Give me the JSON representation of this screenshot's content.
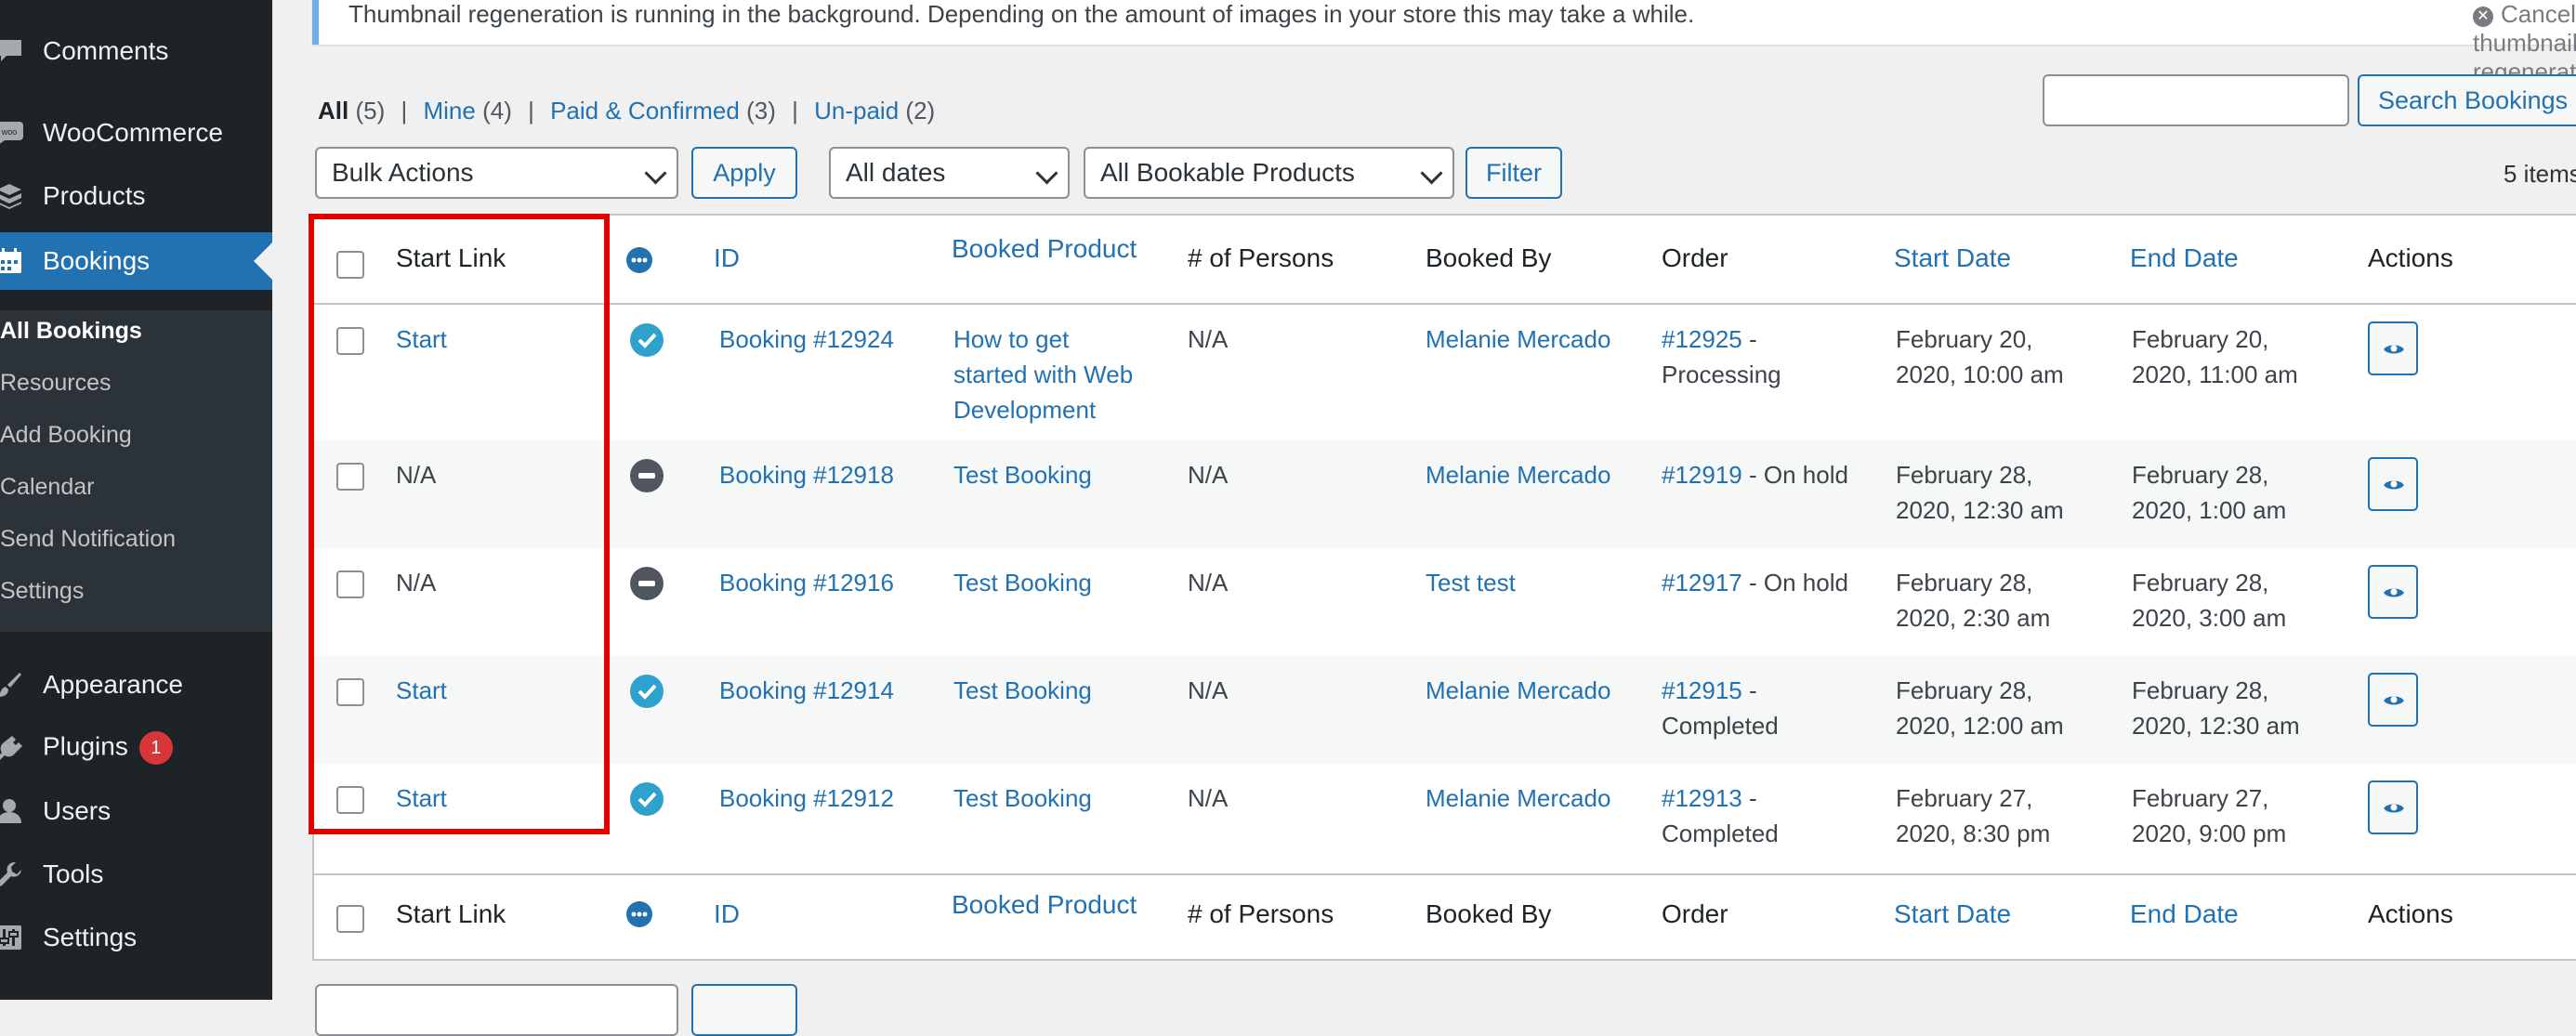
{
  "sidebar": {
    "menu": [
      {
        "label": "Comments",
        "icon": "comment-icon"
      },
      {
        "label": "WooCommerce",
        "icon": "woocommerce-icon"
      },
      {
        "label": "Products",
        "icon": "archive-icon"
      },
      {
        "label": "Bookings",
        "icon": "calendar-icon"
      },
      {
        "label": "Appearance",
        "icon": "paintbrush-icon"
      },
      {
        "label": "Plugins",
        "icon": "plugin-icon",
        "badge": "1"
      },
      {
        "label": "Users",
        "icon": "users-icon"
      },
      {
        "label": "Tools",
        "icon": "wrench-icon"
      },
      {
        "label": "Settings",
        "icon": "settings-icon"
      }
    ],
    "submenu": [
      "All Bookings",
      "Resources",
      "Add Booking",
      "Calendar",
      "Send Notification",
      "Settings"
    ]
  },
  "notice": {
    "text": "Thumbnail regeneration is running in the background. Depending on the amount of images in your store this may take a while.",
    "cancel": "Cancel thumbnail regeneration"
  },
  "views": [
    {
      "label": "All",
      "count": "(5)"
    },
    {
      "label": "Mine",
      "count": "(4)"
    },
    {
      "label": "Paid & Confirmed",
      "count": "(3)"
    },
    {
      "label": "Un-paid",
      "count": "(2)"
    }
  ],
  "views_sep": "|",
  "controls": {
    "bulk_actions": "Bulk Actions",
    "apply": "Apply",
    "dates": "All dates",
    "products": "All Bookable Products",
    "filter": "Filter",
    "search_button": "Search Bookings",
    "search_value": "",
    "items_count": "5 items"
  },
  "columns": [
    "Start Link",
    "ID",
    "Booked Product",
    "# of Persons",
    "Booked By",
    "Order",
    "Start Date",
    "End Date",
    "Actions"
  ],
  "rows": [
    {
      "start_link": "Start",
      "status": "confirmed",
      "id": "Booking #12924",
      "product": [
        "How to get",
        "started with Web",
        "Development"
      ],
      "persons": "N/A",
      "booked_by": "Melanie Mercado",
      "order_num": "#12925",
      "order_status": [
        "-",
        "Processing"
      ],
      "start": [
        "February 20,",
        "2020, 10:00 am"
      ],
      "end": [
        "February 20,",
        "2020, 11:00 am"
      ]
    },
    {
      "start_link": "N/A",
      "status": "unpaid",
      "id": "Booking #12918",
      "product": [
        "Test Booking"
      ],
      "persons": "N/A",
      "booked_by": "Melanie Mercado",
      "order_num": "#12919",
      "order_status": [
        "- On hold"
      ],
      "start": [
        "February 28,",
        "2020, 12:30 am"
      ],
      "end": [
        "February 28,",
        "2020, 1:00 am"
      ]
    },
    {
      "start_link": "N/A",
      "status": "unpaid",
      "id": "Booking #12916",
      "product": [
        "Test Booking"
      ],
      "persons": "N/A",
      "booked_by": "Test test",
      "order_num": "#12917",
      "order_status": [
        "- On hold"
      ],
      "start": [
        "February 28,",
        "2020, 2:30 am"
      ],
      "end": [
        "February 28,",
        "2020, 3:00 am"
      ]
    },
    {
      "start_link": "Start",
      "status": "confirmed",
      "id": "Booking #12914",
      "product": [
        "Test Booking"
      ],
      "persons": "N/A",
      "booked_by": "Melanie Mercado",
      "order_num": "#12915",
      "order_status": [
        "-",
        "Completed"
      ],
      "start": [
        "February 28,",
        "2020, 12:00 am"
      ],
      "end": [
        "February 28,",
        "2020, 12:30 am"
      ]
    },
    {
      "start_link": "Start",
      "status": "confirmed",
      "id": "Booking #12912",
      "product": [
        "Test Booking"
      ],
      "persons": "N/A",
      "booked_by": "Melanie Mercado",
      "order_num": "#12913",
      "order_status": [
        "-",
        "Completed"
      ],
      "start": [
        "February 27,",
        "2020, 8:30 pm"
      ],
      "end": [
        "February 27,",
        "2020, 9:00 pm"
      ]
    }
  ],
  "colors": {
    "sidebar_bg": "#1d2327",
    "active_menu": "#2271b1",
    "link": "#2271b1",
    "status_confirmed": "#2ea2cc",
    "status_unpaid": "#50575e",
    "highlight": "#e00000",
    "badge": "#d63638"
  }
}
